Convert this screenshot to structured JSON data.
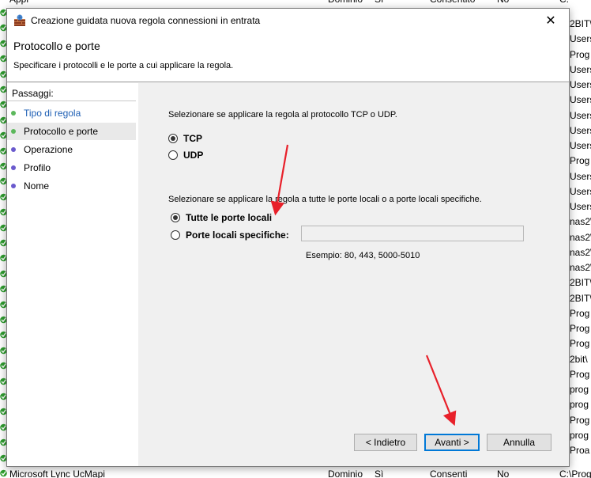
{
  "background_list": {
    "top_row": {
      "col1": "Appl",
      "col2": "Dominio",
      "col3": "Sì",
      "col4": "Consentito",
      "col5": "No",
      "col6": "C:\\Prog"
    },
    "bottom_row": {
      "col1": "Microsoft Lync UcMapi",
      "col2": "Dominio",
      "col3": "Sì",
      "col4": "Consenti",
      "col5": "No",
      "col6": "C:\\Prog"
    },
    "right_rows": [
      "2BIT\\",
      "Users",
      "Prog",
      "Users",
      "Users",
      "Users",
      "Users",
      "Users",
      "Users",
      "Prog",
      "Users",
      "Users",
      "Users",
      "nas2\\",
      "nas2\\",
      "nas2\\",
      "nas2\\",
      "2BIT\\",
      "2BIT\\",
      "Prog",
      "Prog",
      "Prog",
      "2bit\\",
      "Prog",
      "prog",
      "prog",
      "Prog",
      "prog",
      "Proa"
    ]
  },
  "dialog": {
    "title": "Creazione guidata nuova regola connessioni in entrata",
    "close_glyph": "✕",
    "header_title": "Protocollo e porte",
    "header_subtitle": "Specificare i protocolli e le porte a cui applicare la regola.",
    "steps_title": "Passaggi:",
    "steps": [
      {
        "label": "Tipo di regola",
        "state": "done"
      },
      {
        "label": "Protocollo e porte",
        "state": "current"
      },
      {
        "label": "Operazione",
        "state": "pending"
      },
      {
        "label": "Profilo",
        "state": "pending"
      },
      {
        "label": "Nome",
        "state": "pending"
      }
    ],
    "protocol_question": "Selezionare se applicare la regola al protocollo TCP o UDP.",
    "protocol_options": [
      {
        "label": "TCP",
        "checked": true
      },
      {
        "label": "UDP",
        "checked": false
      }
    ],
    "ports_question": "Selezionare se applicare la regola a tutte le porte locali o a porte locali specifiche.",
    "port_options": [
      {
        "label": "Tutte le porte locali",
        "checked": true
      },
      {
        "label": "Porte locali specifiche:",
        "checked": false
      }
    ],
    "ports_input_value": "",
    "ports_example": "Esempio: 80, 443, 5000-5010",
    "buttons": {
      "back": "< Indietro",
      "next": "Avanti >",
      "cancel": "Annulla"
    }
  },
  "colors": {
    "step_done_dot": "#5cb85c",
    "step_current_dot": "#5cb85c",
    "step_pending_dot": "#6a5acd",
    "annotation_arrow": "#e8202a",
    "accent": "#0078d7"
  }
}
